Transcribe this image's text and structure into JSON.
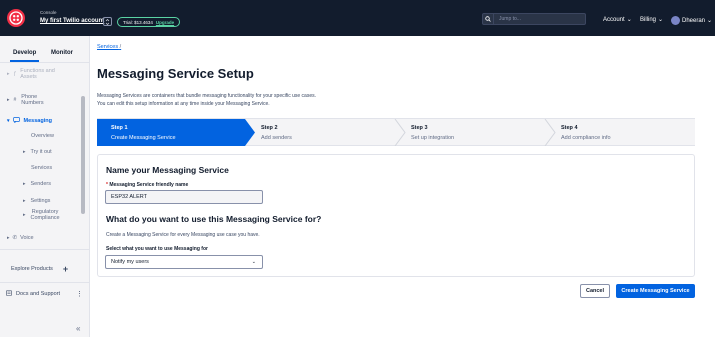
{
  "topbar": {
    "account_caption": "Console",
    "account_name": "My first Twilio account",
    "trial_text": "Trial: $13.4634",
    "upgrade_label": "Upgrade",
    "jump_placeholder": "Jump to...",
    "account_menu": "Account",
    "billing_menu": "Billing",
    "user_name": "Dheeran"
  },
  "sidebar": {
    "tabs": [
      "Develop",
      "Monitor"
    ],
    "functions_label_1": "Functions and",
    "functions_label_2": "Assets",
    "phone_label_1": "Phone",
    "phone_label_2": "Numbers",
    "messaging_label": "Messaging",
    "overview_label": "Overview",
    "tryit_label": "Try it out",
    "services_label": "Services",
    "senders_label": "Senders",
    "settings_label": "Settings",
    "regulatory_label_1": "Regulatory",
    "regulatory_label_2": "Compliance",
    "voice_label": "Voice",
    "explore_label": "Explore Products",
    "docs_label": "Docs and Support"
  },
  "main": {
    "breadcrumb": "Services",
    "breadcrumb_sep": "/",
    "title": "Messaging Service Setup",
    "desc_line1": "Messaging Services are containers that bundle messaging functionality for your specific use cases.",
    "desc_line2": "You can edit this setup information at any time inside your Messaging Service."
  },
  "steps": [
    {
      "num": "Step 1",
      "label": "Create Messaging Service"
    },
    {
      "num": "Step 2",
      "label": "Add senders"
    },
    {
      "num": "Step 3",
      "label": "Set up integration"
    },
    {
      "num": "Step 4",
      "label": "Add compliance info"
    }
  ],
  "form": {
    "section_title": "Name your Messaging Service",
    "required_mark": "*",
    "name_label": "Messaging Service friendly name",
    "name_value": "ESP32 ALERT",
    "usecase_title": "What do you want to use this Messaging Service for?",
    "usecase_help": "Create a Messaging Service for every Messaging use case you have.",
    "select_label": "Select what you want to use Messaging for",
    "select_value": "Notify my users"
  },
  "actions": {
    "cancel": "Cancel",
    "create": "Create Messaging Service"
  },
  "colors": {
    "topbar": "#121c2d",
    "accent": "#0263e0",
    "logo": "#f22f46",
    "trial": "#5ad3a4"
  }
}
